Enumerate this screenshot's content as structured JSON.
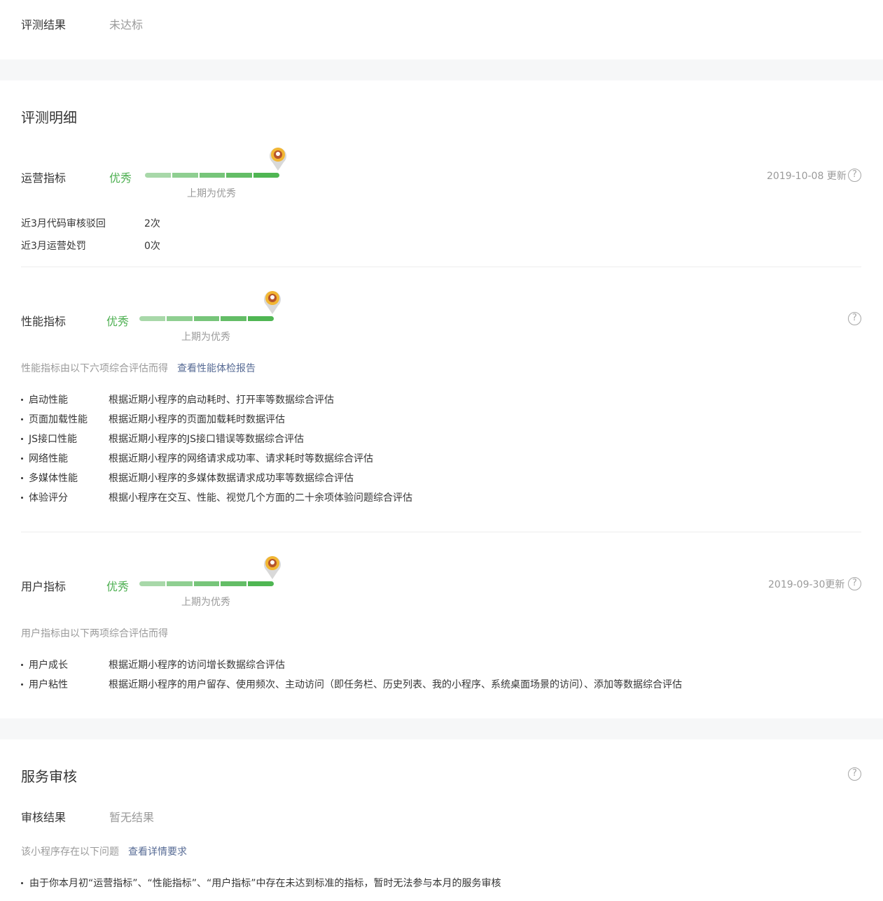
{
  "result": {
    "label": "评测结果",
    "value": "未达标"
  },
  "detail": {
    "title": "评测明细",
    "operation": {
      "label": "运营指标",
      "grade": "优秀",
      "prev": "上期为优秀",
      "updated": "2019-10-08 更新",
      "level": 1.0,
      "rows": [
        {
          "label": "近3月代码审核驳回",
          "value": "2次"
        },
        {
          "label": "近3月运营处罚",
          "value": "0次"
        }
      ]
    },
    "performance": {
      "label": "性能指标",
      "grade": "优秀",
      "prev": "上期为优秀",
      "level": 1.0,
      "intro": "性能指标由以下六项综合评估而得",
      "link": "查看性能体检报告",
      "items": [
        {
          "name": "启动性能",
          "desc": "根据近期小程序的启动耗时、打开率等数据综合评估"
        },
        {
          "name": "页面加载性能",
          "desc": "根据近期小程序的页面加载耗时数据评估"
        },
        {
          "name": "JS接口性能",
          "desc": "根据近期小程序的JS接口错误等数据综合评估"
        },
        {
          "name": "网络性能",
          "desc": "根据近期小程序的网络请求成功率、请求耗时等数据综合评估"
        },
        {
          "name": "多媒体性能",
          "desc": "根据近期小程序的多媒体数据请求成功率等数据综合评估"
        },
        {
          "name": "体验评分",
          "desc": "根据小程序在交互、性能、视觉几个方面的二十余项体验问题综合评估"
        }
      ]
    },
    "user": {
      "label": "用户指标",
      "grade": "优秀",
      "prev": "上期为优秀",
      "updated": "2019-09-30更新",
      "level": 1.0,
      "intro": "用户指标由以下两项综合评估而得",
      "items": [
        {
          "name": "用户成长",
          "desc": "根据近期小程序的访问增长数据综合评估"
        },
        {
          "name": "用户粘性",
          "desc": "根据近期小程序的用户留存、使用频次、主动访问（即任务栏、历史列表、我的小程序、系统桌面场景的访问）、添加等数据综合评估"
        }
      ]
    }
  },
  "service": {
    "title": "服务审核",
    "result_label": "审核结果",
    "result_value": "暂无结果",
    "intro": "该小程序存在以下问题",
    "link": "查看详情要求",
    "issues": [
      "由于你本月初“运营指标”、“性能指标”、“用户指标”中存在未达到标准的指标，暂时无法参与本月的服务审核"
    ]
  },
  "icons": {
    "help": "?",
    "pin": "pin-badge-icon"
  },
  "colors": {
    "grade": "#4caf50",
    "link": "#576b95"
  }
}
